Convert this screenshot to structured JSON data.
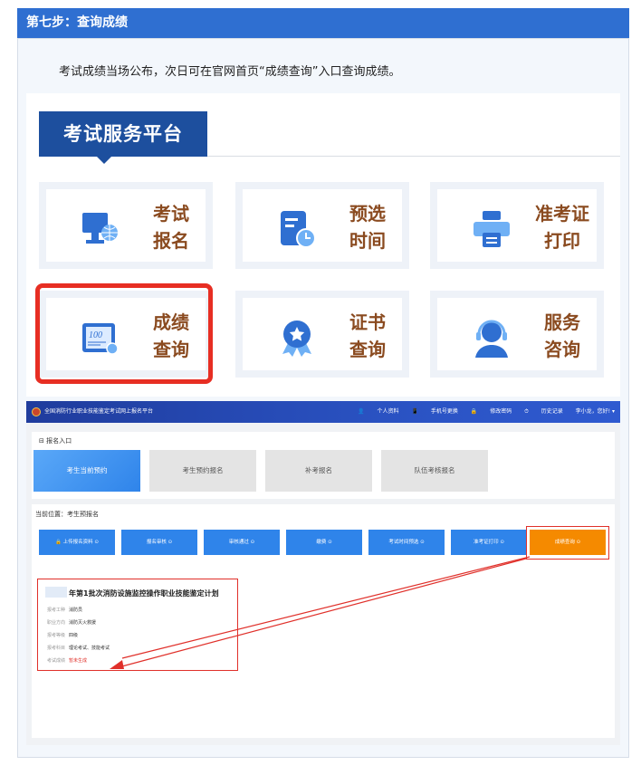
{
  "step": {
    "title": "第七步：查询成绩"
  },
  "intro": "考试成绩当场公布，次日可在官网首页“成绩查询”入口查询成绩。",
  "platform": {
    "title": "考试服务平台",
    "cards": [
      {
        "name": "exam-signup",
        "line1": "考试",
        "line2": "报名",
        "icon": "monitor-globe-icon"
      },
      {
        "name": "preselect-time",
        "line1": "预选",
        "line2": "时间",
        "icon": "doc-clock-icon"
      },
      {
        "name": "admission-print",
        "line1": "准考证",
        "line2": "打印",
        "icon": "printer-icon"
      },
      {
        "name": "score-query",
        "line1": "成绩",
        "line2": "查询",
        "icon": "score-sheet-icon"
      },
      {
        "name": "cert-query",
        "line1": "证书",
        "line2": "查询",
        "icon": "medal-icon"
      },
      {
        "name": "service-consult",
        "line1": "服务",
        "line2": "咨询",
        "icon": "headset-icon"
      }
    ]
  },
  "screen": {
    "app_title": "全国消防行业职业技能鉴定考试网上报名平台",
    "top_links": [
      "个人资料",
      "手机号更换",
      "修改密码",
      "历史记录"
    ],
    "user_greeting": "李小龙，您好! ▾",
    "entry": {
      "heading": "报名入口",
      "tabs": [
        "考生当前预约",
        "考生预约报名",
        "补考报名",
        "队伍考核报名"
      ]
    },
    "location": "当前位置：考生预报名",
    "steps": [
      "上传报名资料",
      "报名审核",
      "审核通过",
      "缴费",
      "考试时间预选",
      "准考证打印",
      "成绩查询"
    ],
    "plan": {
      "title": "年第1批次消防设施监控操作职业技能鉴定计划",
      "rows": [
        {
          "label": "报考工种",
          "value": "消防员"
        },
        {
          "label": "职业方向",
          "value": "消防灭火救援"
        },
        {
          "label": "报考等级",
          "value": "四级"
        },
        {
          "label": "报考科目",
          "value": "理论考试、技能考试"
        },
        {
          "label": "考试成绩",
          "value": "暂未生成"
        }
      ]
    }
  }
}
